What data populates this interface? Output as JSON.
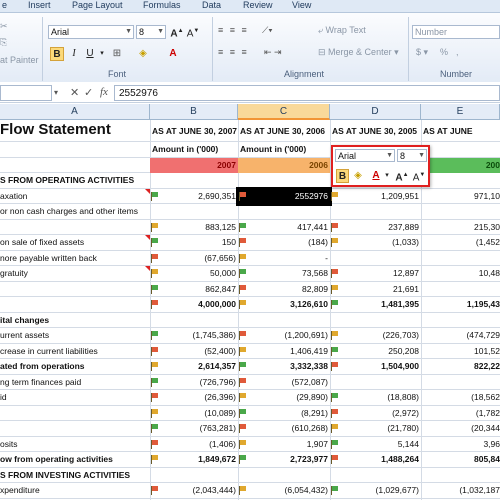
{
  "ribbon": {
    "tabs": [
      "e",
      "Insert",
      "Page Layout",
      "Formulas",
      "Data",
      "Review",
      "View"
    ],
    "font": {
      "name": "Arial",
      "size": "8",
      "group_label": "Font"
    },
    "clipboard": {
      "format_painter": "at Painter"
    },
    "alignment": {
      "wrap_text": "Wrap Text",
      "merge_center": "Merge & Center",
      "group_label": "Alignment"
    },
    "number": {
      "format": "Number",
      "currency": "$",
      "percent": "%",
      "comma": ",",
      "group_label": "Number"
    }
  },
  "formula_bar": {
    "value": "2552976",
    "fx": "fx"
  },
  "columns": [
    "A",
    "B",
    "C",
    "D",
    "E"
  ],
  "sheet": {
    "title": "Flow Statement",
    "headers": [
      "AS AT JUNE 30, 2007",
      "AS AT JUNE 30, 2006",
      "AS AT JUNE 30, 2005",
      "AS AT JUNE"
    ],
    "amount_label_b": "Amount in ('000)",
    "amount_label_c": "Amount in ('000)",
    "year_b": "2007",
    "year_c": "2006",
    "year_e": "200",
    "rows": [
      [
        "S FROM OPERATING ACTIVITIES",
        "",
        "",
        "",
        ""
      ],
      [
        "axation",
        "2,690,351",
        "2552976",
        "1,209,951",
        "971,10"
      ],
      [
        "or non cash charges and other items",
        "",
        "",
        "",
        ""
      ],
      [
        "",
        "883,125",
        "417,441",
        "237,889",
        "215,30"
      ],
      [
        "on sale of fixed assets",
        "150",
        "(184)",
        "(1,033)",
        "(1,452"
      ],
      [
        "nore payable written back",
        "(67,656)",
        "-",
        "",
        ""
      ],
      [
        "gratuity",
        "50,000",
        "73,568",
        "12,897",
        "10,48"
      ],
      [
        "",
        "862,847",
        "82,809",
        "21,691",
        ""
      ],
      [
        "",
        "4,000,000",
        "3,126,610",
        "1,481,395",
        "1,195,43"
      ],
      [
        "ital changes",
        "",
        "",
        "",
        ""
      ],
      [
        "urrent assets",
        "(1,745,386)",
        "(1,200,691)",
        "(226,703)",
        "(474,729"
      ],
      [
        "crease in current liabilities",
        "(52,400)",
        "1,406,419",
        "250,208",
        "101,52"
      ],
      [
        "ated from operations",
        "2,614,357",
        "3,332,338",
        "1,504,900",
        "822,22"
      ],
      [
        "ng term finances paid",
        "(726,796)",
        "(572,087)",
        "",
        ""
      ],
      [
        "id",
        "(26,396)",
        "(29,890)",
        "(18,808)",
        "(18,562"
      ],
      [
        "",
        "(10,089)",
        "(8,291)",
        "(2,972)",
        "(1,782"
      ],
      [
        "",
        "(763,281)",
        "(610,268)",
        "(21,780)",
        "(20,344"
      ],
      [
        "osits",
        "(1,406)",
        "1,907",
        "5,144",
        "3,96"
      ],
      [
        "ow from operating activities",
        "1,849,672",
        "2,723,977",
        "1,488,264",
        "805,84"
      ],
      [
        "S FROM INVESTING ACTIVITIES",
        "",
        "",
        "",
        ""
      ],
      [
        "xpenditure",
        "(2,043,444)",
        "(6,054,432)",
        "(1,029,677)",
        "(1,032,187"
      ]
    ]
  },
  "mini_toolbar": {
    "font": "Arial",
    "size": "8"
  },
  "colors": {
    "red_header": "#f07070",
    "orange_header": "#f7b36b",
    "green_header": "#5bbd5b",
    "accent": "#e02020"
  }
}
